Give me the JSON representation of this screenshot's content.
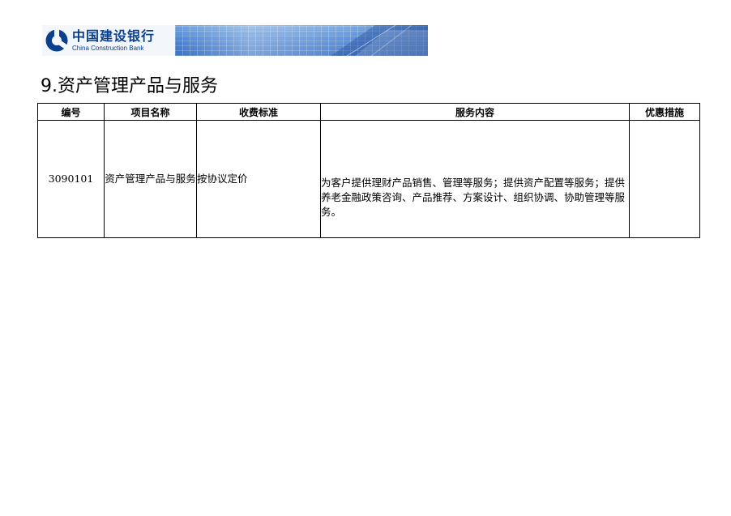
{
  "banner": {
    "bank_name_cn": "中国建设银行",
    "bank_name_en": "China Construction Bank",
    "logo_icon": "ccb-logo-icon",
    "brand_color": "#0a3f8e"
  },
  "section": {
    "title": "9.资产管理产品与服务"
  },
  "table": {
    "headers": {
      "code": "编号",
      "name": "项目名称",
      "fee": "收费标准",
      "content": "服务内容",
      "discount": "优惠措施"
    },
    "rows": [
      {
        "code": "3090101",
        "name": "资产管理产品与服务",
        "fee": "按协议定价",
        "content": "为客户提供理财产品销售、管理等服务；提供资产配置等服务；提供养老金融政策咨询、产品推荐、方案设计、组织协调、协助管理等服务。",
        "discount": ""
      }
    ]
  }
}
